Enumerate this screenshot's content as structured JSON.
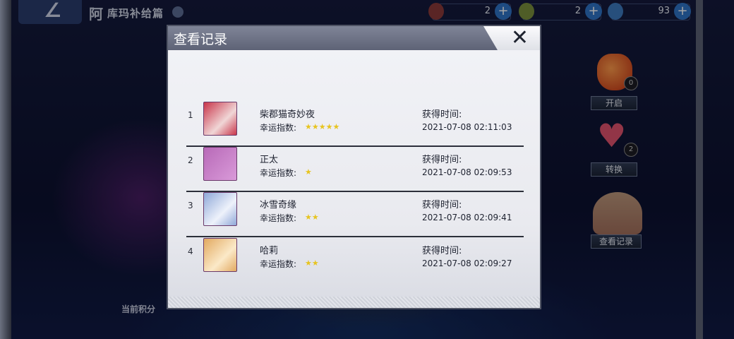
{
  "topbar": {
    "title_mark": "阿",
    "title": "库玛补给篇",
    "resources": [
      {
        "icon": "feather-icon",
        "value": "2",
        "color": "#8b3a3a"
      },
      {
        "icon": "gem-icon",
        "value": "2",
        "color": "#7a8f3c"
      },
      {
        "icon": "crystal-icon",
        "value": "93",
        "color": "#3c7abf"
      }
    ]
  },
  "side": {
    "open_label": "开启",
    "open_count": "0",
    "convert_label": "转换",
    "convert_count": "2",
    "records_label": "查看记录"
  },
  "bottom": {
    "score_label": "当前积分"
  },
  "modal": {
    "title": "查看记录",
    "time_label": "获得时间:",
    "luck_label": "幸运指数:",
    "records": [
      {
        "rank": "1",
        "name": "柴郡猫奇妙夜",
        "stars": 5,
        "time": "2021-07-08 02:11:03",
        "avatar_color": "#c9354a"
      },
      {
        "rank": "2",
        "name": "正太",
        "stars": 1,
        "time": "2021-07-08 02:09:53",
        "avatar_color": "#b86ab8"
      },
      {
        "rank": "3",
        "name": "冰雪奇缘",
        "stars": 2,
        "time": "2021-07-08 02:09:41",
        "avatar_color": "#8fa8d8"
      },
      {
        "rank": "4",
        "name": "哈莉",
        "stars": 2,
        "time": "2021-07-08 02:09:27",
        "avatar_color": "#e2a960"
      }
    ]
  }
}
